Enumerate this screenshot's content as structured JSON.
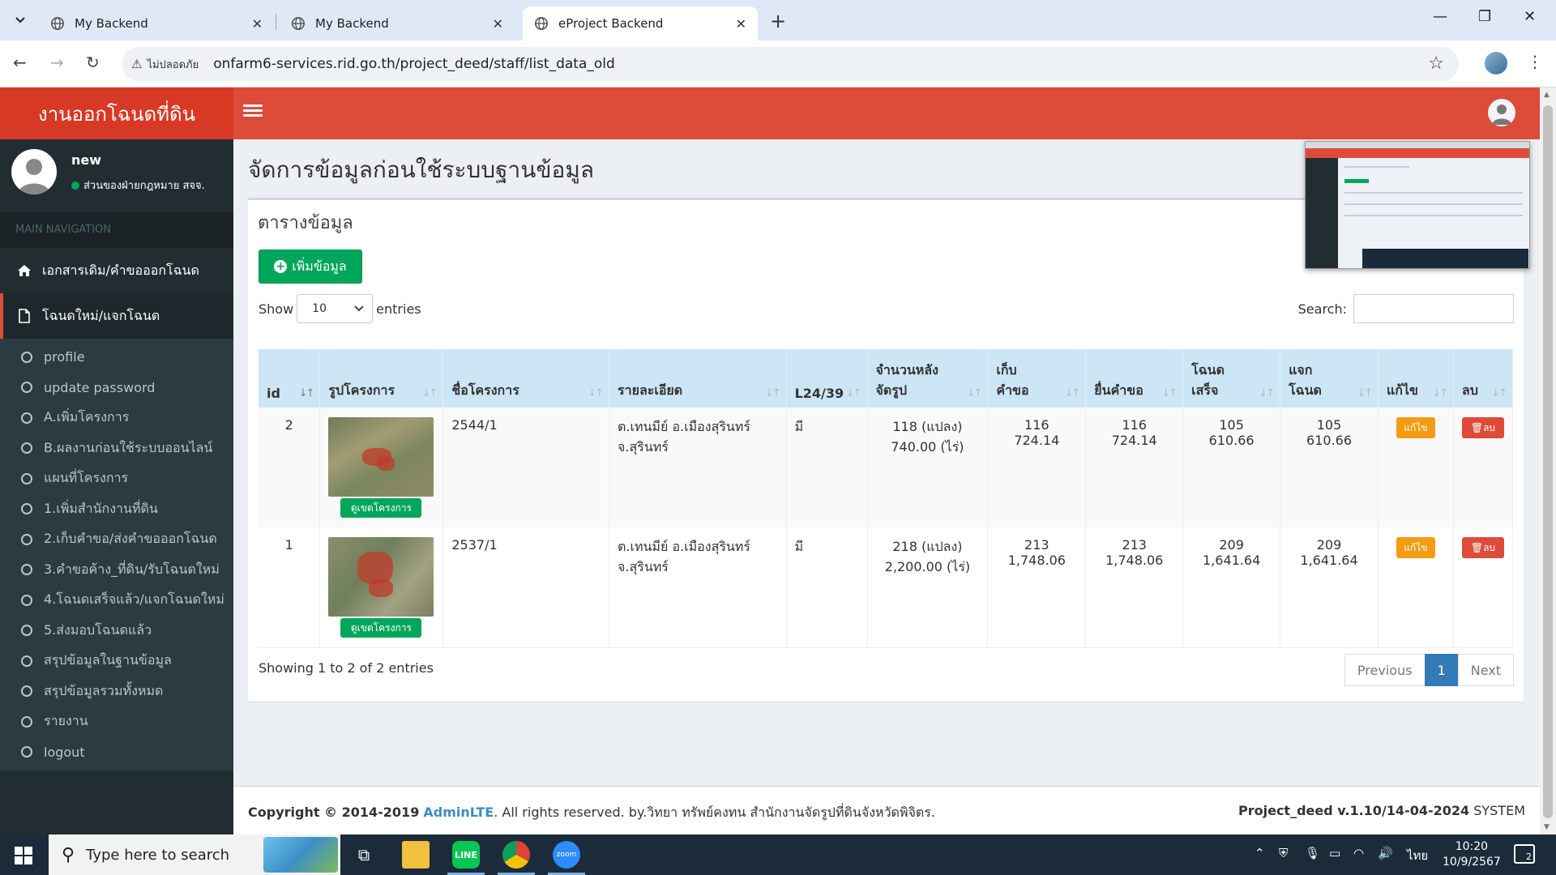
{
  "browser": {
    "tabs": [
      {
        "title": "My Backend",
        "active": false
      },
      {
        "title": "My Backend",
        "active": false
      },
      {
        "title": "eProject Backend",
        "active": true
      }
    ],
    "security_label": "ไม่ปลอดภัย",
    "url": "onfarm6-services.rid.go.th/project_deed/staff/list_data_old"
  },
  "app": {
    "logo": "งานออกโฉนดที่ดิน",
    "user": {
      "name": "new",
      "status": "ส่วนของฝ่ายกฎหมาย สจจ."
    },
    "nav_header": "MAIN NAVIGATION",
    "nav_main": [
      {
        "label": "เอกสารเดิม/คำขอออกโฉนด",
        "icon": "home-icon",
        "active": false
      },
      {
        "label": "โฉนดใหม่/แจกโฉนด",
        "icon": "file-icon",
        "active": true
      }
    ],
    "submenu": [
      "profile",
      "update password",
      "A.เพิ่มโครงการ",
      "B.ผลงานก่อนใช้ระบบออนไลน์",
      "แผนที่โครงการ",
      "1.เพิ่มสำนักงานที่ดิน",
      "2.เก็บคำขอ/ส่งคำขอออกโฉนด",
      "3.คำขอค้าง_ที่ดิน/รับโฉนดใหม่",
      "4.โฉนดเสร็จแล้ว/แจกโฉนดใหม่",
      "5.ส่งมอบโฉนดแล้ว",
      "สรุปข้อมูลในฐานข้อมูล",
      "สรุปข้อมูลรวมทั้งหมด",
      "รายงาน",
      "logout"
    ]
  },
  "content": {
    "page_title": "จัดการข้อมูลก่อนใช้ระบบฐานข้อมูล",
    "box_title": "ตารางข้อมูล",
    "add_button": "เพิ่มข้อมูล",
    "length": {
      "show": "Show",
      "value": "10",
      "entries": "entries"
    },
    "search_label": "Search:",
    "table": {
      "headers": [
        {
          "line1": "",
          "line2": "id"
        },
        {
          "line1": "",
          "line2": "รูปโครงการ"
        },
        {
          "line1": "",
          "line2": "ชื่อโครงการ"
        },
        {
          "line1": "",
          "line2": "รายละเอียด"
        },
        {
          "line1": "",
          "line2": "L24/39"
        },
        {
          "line1": "จำนวนหลัง",
          "line2": "จัดรูป"
        },
        {
          "line1": "เก็บ",
          "line2": "คำขอ"
        },
        {
          "line1": "",
          "line2": "ยื่นคำขอ"
        },
        {
          "line1": "โฉนด",
          "line2": "เสร็จ"
        },
        {
          "line1": "แจก",
          "line2": "โฉนด"
        },
        {
          "line1": "",
          "line2": "แก้ไข"
        },
        {
          "line1": "",
          "line2": "ลบ"
        }
      ],
      "rows": [
        {
          "id": "2",
          "view_btn": "ดูเขตโครงการ",
          "name": "2544/1",
          "detail_l1": "ต.เทนมีย์ อ.เมืองสุรินทร์",
          "detail_l2": "จ.สุรินทร์",
          "l24": "มี",
          "plots_l1": "118 (แปลง)",
          "plots_l2": "740.00 (ไร่)",
          "collect_l1": "116",
          "collect_l2": "724.14",
          "submit_l1": "116",
          "submit_l2": "724.14",
          "done_l1": "105",
          "done_l2": "610.66",
          "dist_l1": "105",
          "dist_l2": "610.66",
          "edit": "แก้ไข",
          "delete": "ลบ"
        },
        {
          "id": "1",
          "view_btn": "ดูเขตโครงการ",
          "name": "2537/1",
          "detail_l1": "ต.เทนมีย์ อ.เมืองสุรินทร์",
          "detail_l2": "จ.สุรินทร์",
          "l24": "มี",
          "plots_l1": "218 (แปลง)",
          "plots_l2": "2,200.00 (ไร่)",
          "collect_l1": "213",
          "collect_l2": "1,748.06",
          "submit_l1": "213",
          "submit_l2": "1,748.06",
          "done_l1": "209",
          "done_l2": "1,641.64",
          "dist_l1": "209",
          "dist_l2": "1,641.64",
          "edit": "แก้ไข",
          "delete": "ลบ"
        }
      ]
    },
    "info": "Showing 1 to 2 of 2 entries",
    "pager": {
      "prev": "Previous",
      "current": "1",
      "next": "Next"
    }
  },
  "footer": {
    "copyright": "Copyright © 2014-2019",
    "brand": "AdminLTE",
    "rest": ". All rights reserved. by.วิทยา ทรัพย์คงทน สำนักงานจัดรูปที่ดินจังหวัดพิจิตร.",
    "version": "Project_deed v.1.10/14-04-2024",
    "system": "SYSTEM"
  },
  "taskbar": {
    "search_placeholder": "Type here to search",
    "lang": "ไทย",
    "time": "10:20",
    "date": "10/9/2567",
    "notif_count": "2",
    "apps": [
      "task-view-icon",
      "file-explorer-icon",
      "line-icon",
      "chrome-icon",
      "zoom-icon"
    ],
    "line_label": "LINE",
    "zoom_label": "zoom"
  },
  "colors": {
    "header": "#dd4b39",
    "logo": "#d73925",
    "sidebar": "#222d32",
    "add_button": "#00a65a",
    "edit_button": "#f39c12",
    "delete_button": "#dd4b39",
    "table_header": "#cde6f5",
    "pager_active": "#337ab7"
  }
}
